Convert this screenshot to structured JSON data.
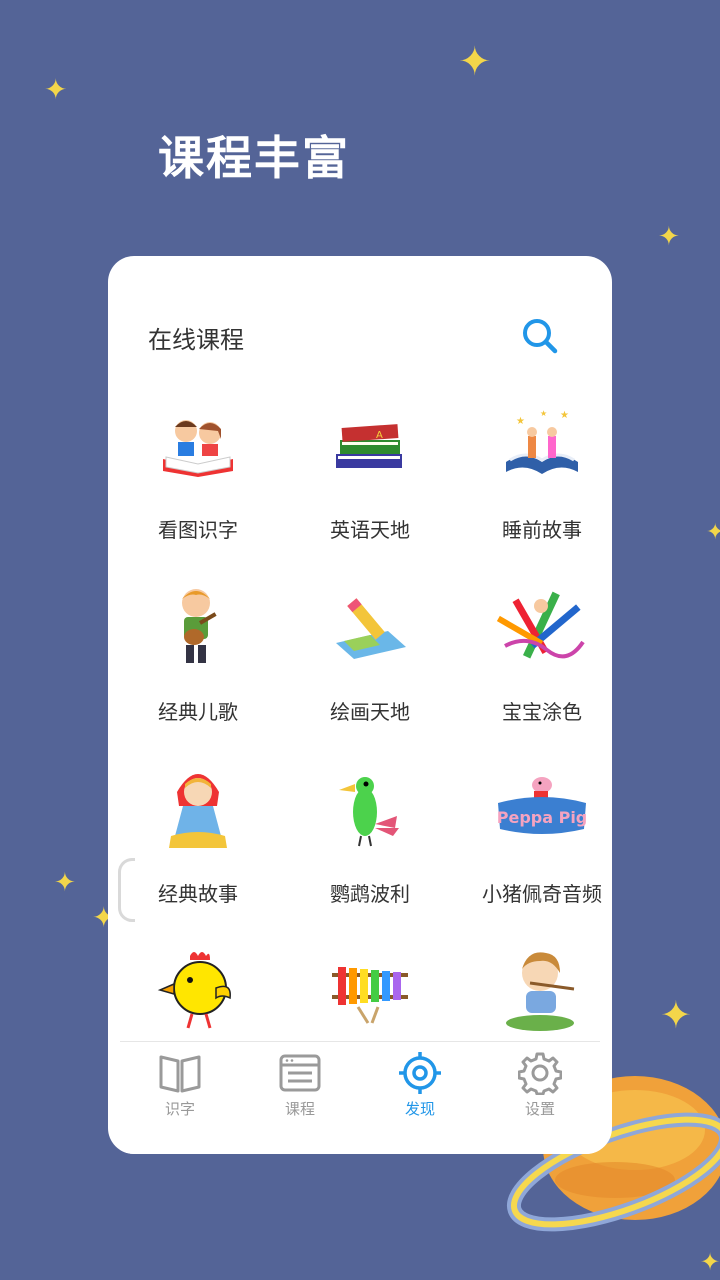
{
  "promo": {
    "headline": "课程丰富"
  },
  "card": {
    "title": "在线课程",
    "search_icon": "search-icon"
  },
  "courses": [
    {
      "label": "看图识字",
      "icon": "kids-reading-icon"
    },
    {
      "label": "英语天地",
      "icon": "books-stack-icon"
    },
    {
      "label": "睡前故事",
      "icon": "storybook-icon"
    },
    {
      "label": "经典儿歌",
      "icon": "boy-guitar-icon"
    },
    {
      "label": "绘画天地",
      "icon": "pencil-paper-icon"
    },
    {
      "label": "宝宝涂色",
      "icon": "crayons-icon"
    },
    {
      "label": "经典故事",
      "icon": "girl-hood-icon"
    },
    {
      "label": "鹦鹉波利",
      "icon": "parrot-icon"
    },
    {
      "label": "小猪佩奇音频",
      "icon": "peppa-pig-icon"
    },
    {
      "label": "",
      "icon": "chick-icon"
    },
    {
      "label": "",
      "icon": "xylophone-icon"
    },
    {
      "label": "",
      "icon": "boy-flute-icon"
    }
  ],
  "peppa_logo_text": "Peppa Pig",
  "tabs": [
    {
      "label": "识字",
      "icon": "book-icon",
      "active": false
    },
    {
      "label": "课程",
      "icon": "course-list-icon",
      "active": false
    },
    {
      "label": "发现",
      "icon": "target-icon",
      "active": true
    },
    {
      "label": "设置",
      "icon": "gear-icon",
      "active": false
    }
  ],
  "colors": {
    "background": "#546497",
    "accent": "#2196e8",
    "star": "#f3d64a",
    "tab_inactive": "#999999"
  }
}
